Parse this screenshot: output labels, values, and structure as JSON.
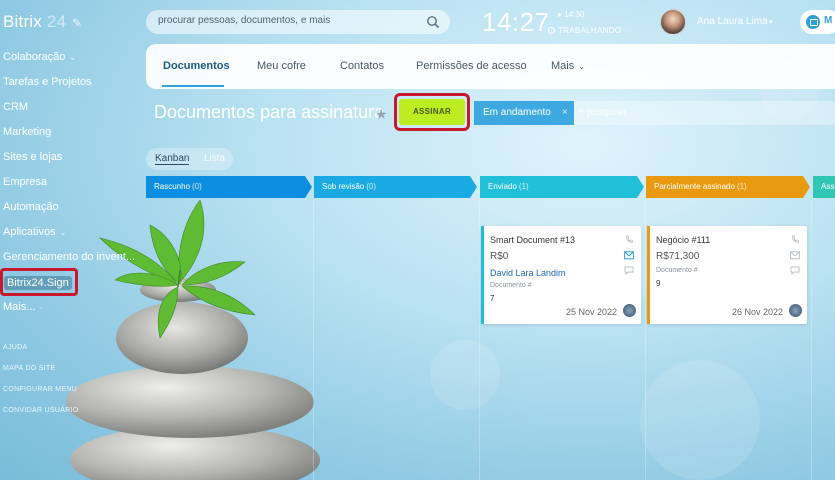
{
  "app": {
    "logo_text": "Bitrix",
    "logo_num": "24"
  },
  "sidebar": {
    "items": [
      {
        "label": "Colaboração",
        "has_chevron": true
      },
      {
        "label": "Tarefas e Projetos"
      },
      {
        "label": "CRM"
      },
      {
        "label": "Marketing"
      },
      {
        "label": "Sites e lojas"
      },
      {
        "label": "Empresa"
      },
      {
        "label": "Automação"
      },
      {
        "label": "Aplicativos",
        "has_chevron": true
      },
      {
        "label": "Gerenciamento do invent..."
      }
    ],
    "sign_item": "Bitrix24.Sign",
    "more": "Mais...",
    "links": [
      "AJUDA",
      "MAPA DO SITE",
      "CONFIGURAR MENU",
      "CONVIDAR USUÁRIO"
    ]
  },
  "header": {
    "search_placeholder": "procurar pessoas, documentos, e mais",
    "time": "14:27",
    "time_small": "14:30",
    "status": "TRABALHANDO",
    "user_name": "Ana Laura Lima",
    "messenger_initial": "M"
  },
  "tabs": {
    "items": [
      "Documentos",
      "Meu cofre",
      "Contatos",
      "Permissões de acesso",
      "Mais"
    ],
    "active": "Documentos"
  },
  "page": {
    "title": "Documentos para assinatura",
    "sign_button": "ASSINAR",
    "filter_chip": "Em andamento",
    "filter_placeholder": "+ pesquisa"
  },
  "view_toggle": {
    "kanban": "Kanban",
    "list": "Lista"
  },
  "stages": [
    {
      "name": "Rascunho",
      "count": "(0)",
      "color": "#0e8ee0"
    },
    {
      "name": "Sob revisão",
      "count": "(0)",
      "color": "#1aa9e3"
    },
    {
      "name": "Enviado",
      "count": "(1)",
      "color": "#22bfd8"
    },
    {
      "name": "Parcialmente assinado",
      "count": "(1)",
      "color": "#e99a10"
    },
    {
      "name": "Assi",
      "count": "",
      "color": "#2fc6b3"
    }
  ],
  "cards": [
    {
      "title": "Smart Document #13",
      "amount": "R$0",
      "person": "David Lara Landim",
      "doc_label": "Documento #",
      "doc_number": "7",
      "date": "25 Nov 2022",
      "accent": "#22bfd8"
    },
    {
      "title": "Negócio #111",
      "amount": "R$71,300",
      "person": "",
      "doc_label": "Documento #",
      "doc_number": "9",
      "date": "26 Nov 2022",
      "accent": "#e99a10"
    }
  ]
}
